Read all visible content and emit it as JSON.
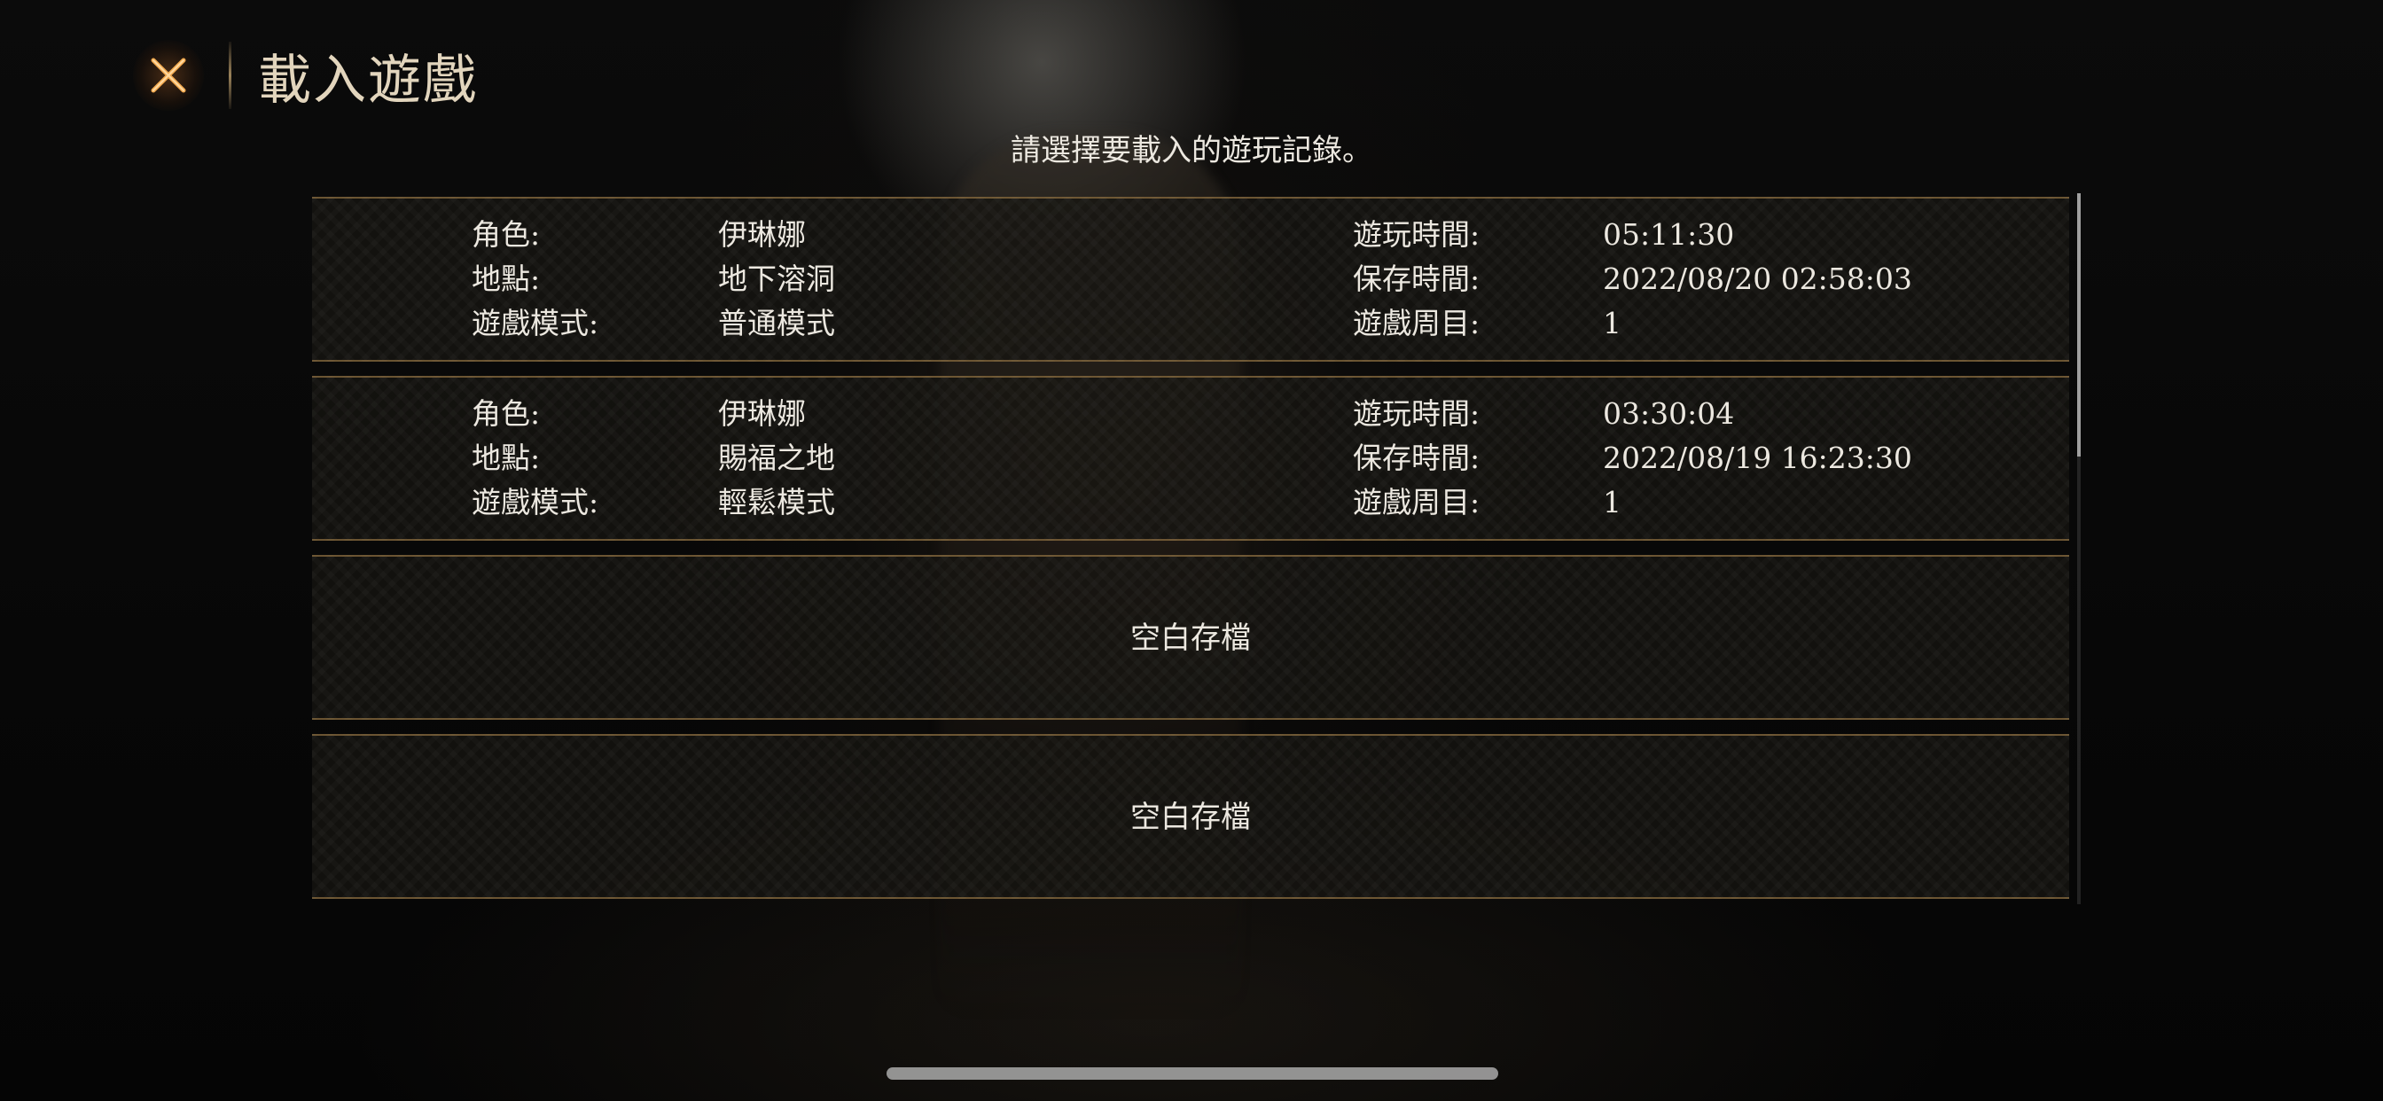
{
  "header": {
    "title": "載入遊戲",
    "close_icon": "close-x-icon"
  },
  "subtitle": "請選擇要載入的遊玩記錄。",
  "saves": [
    {
      "character_label": "角色:",
      "character": "伊琳娜",
      "location_label": "地點:",
      "location": "地下溶洞",
      "mode_label": "遊戲模式:",
      "mode": "普通模式",
      "playtime_label": "遊玩時間:",
      "playtime": "05:11:30",
      "saved_label": "保存時間:",
      "saved": "2022/08/20 02:58:03",
      "cycle_label": "遊戲周目:",
      "cycle": "1"
    },
    {
      "character_label": "角色:",
      "character": "伊琳娜",
      "location_label": "地點:",
      "location": "賜福之地",
      "mode_label": "遊戲模式:",
      "mode": "輕鬆模式",
      "playtime_label": "遊玩時間:",
      "playtime": "03:30:04",
      "saved_label": "保存時間:",
      "saved": "2022/08/19 16:23:30",
      "cycle_label": "遊戲周目:",
      "cycle": "1"
    }
  ],
  "empty_slots": [
    {
      "label": "空白存檔"
    },
    {
      "label": "空白存檔"
    }
  ],
  "colors": {
    "accent_gold": "#b48c50",
    "title_text": "#e2d5bd",
    "close_glow": "#c8782a"
  },
  "scroll": {
    "thumb_fraction": 0.37
  }
}
